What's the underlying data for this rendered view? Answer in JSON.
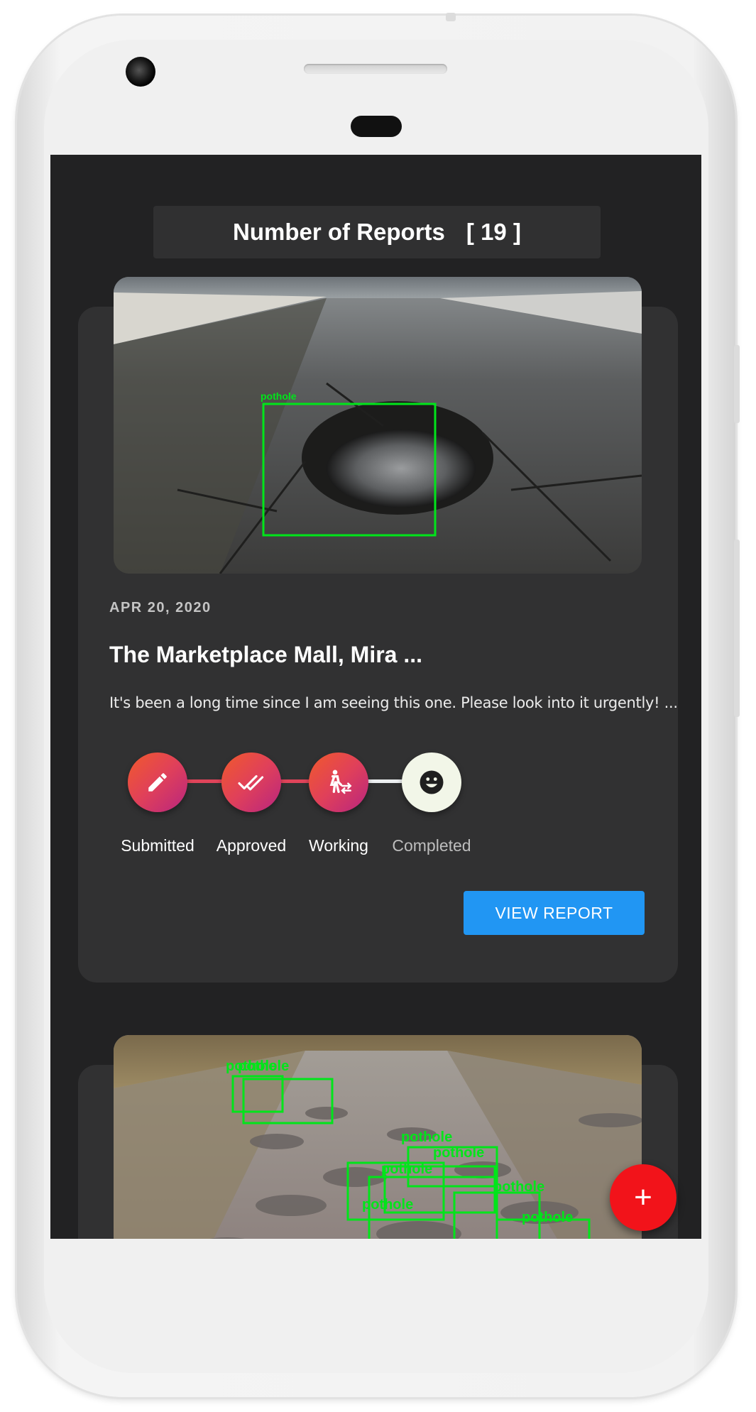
{
  "header": {
    "label": "Number of Reports",
    "count": "[ 19 ]"
  },
  "reports": [
    {
      "date": "APR 20, 2020",
      "title": "The Marketplace Mall, Mira ...",
      "description": "It's been a long time since I am seeing this one. Please look into it urgently! ...",
      "detection_label": "pothole",
      "steps": [
        {
          "label": "Submitted",
          "icon": "pencil-icon",
          "state": "active"
        },
        {
          "label": "Approved",
          "icon": "double-check-icon",
          "state": "active"
        },
        {
          "label": "Working",
          "icon": "worker-icon",
          "state": "active"
        },
        {
          "label": "Completed",
          "icon": "smile-icon",
          "state": "pending"
        }
      ],
      "view_button": "VIEW REPORT"
    },
    {
      "detection_label": "pothole"
    }
  ],
  "fab": {
    "label": "+",
    "icon": "plus-icon"
  },
  "colors": {
    "screen_bg": "#222223",
    "card_bg": "#313132",
    "accent_blue": "#2196f3",
    "step_gradient_start": "#f15a2b",
    "step_gradient_end": "#b8257f",
    "fab_red": "#f2131a",
    "detection_green": "#00ff00"
  }
}
